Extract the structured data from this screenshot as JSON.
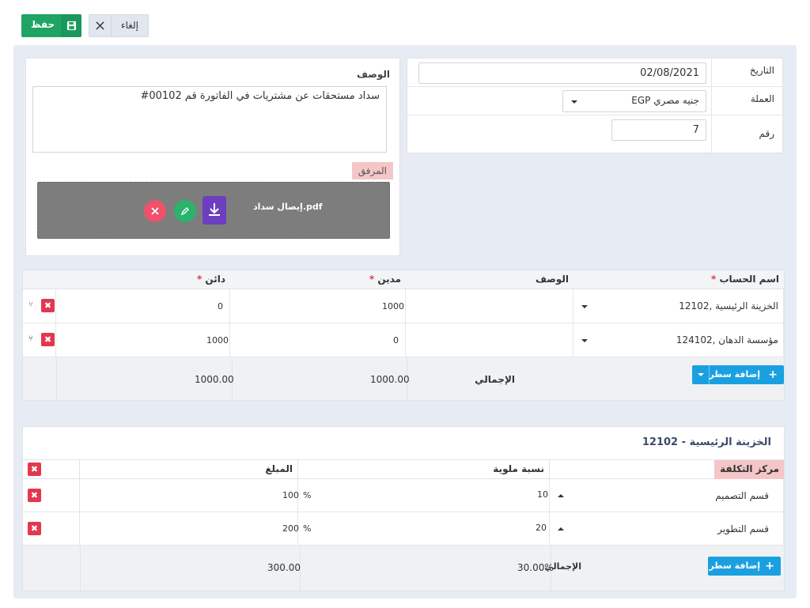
{
  "toolbar": {
    "save_label": "حفظ",
    "cancel_label": "إلغاء"
  },
  "meta": {
    "date_label": "التاريخ",
    "date_value": "02/08/2021",
    "currency_label": "العملة",
    "currency_value": "EGP جنيه مصري",
    "number_label": "رقم",
    "number_value": "7"
  },
  "description": {
    "label": "الوصف",
    "value": "سداد مستحقات عن مشتريات في الفاتورة قم 00102#",
    "attachment_label": "المرفق",
    "attachment_file": "إيصال سداد.pdf"
  },
  "journal": {
    "headers": {
      "account": "اسم الحساب",
      "description": "الوصف",
      "debit": "مدين",
      "credit": "دائن"
    },
    "required_mark": "*",
    "rows": [
      {
        "account": "12102, الخزينة الرئيسية",
        "description": "",
        "debit": "1000",
        "credit": "0"
      },
      {
        "account": "124102, مؤسسة الدهان",
        "description": "",
        "debit": "0",
        "credit": "1000"
      }
    ],
    "total_label": "الإجمالي",
    "total_debit": "1000.00",
    "total_credit": "1000.00",
    "add_line_label": "إضافة سطر"
  },
  "cost_center": {
    "title": "12102 - الخزينة الرئيسية",
    "headers": {
      "center": "مركز التكلفة",
      "percent": "نسبة ملوية",
      "amount": "المبلغ"
    },
    "rows": [
      {
        "center": "قسم التصميم",
        "percent": "10",
        "amount": "100",
        "pct_sign": "%"
      },
      {
        "center": "قسم التطوير",
        "percent": "20",
        "amount": "200",
        "pct_sign": "%"
      }
    ],
    "total_label": "الإجمالي",
    "total_percent": "30.00%",
    "total_amount": "300.00",
    "add_line_label": "إضافة سطر"
  },
  "colors": {
    "save": "#1fa463",
    "danger": "#e2384d",
    "primary": "#1aa0e0",
    "panel": "#e7ecf4",
    "attachment_label_bg": "#f5c6c8"
  }
}
